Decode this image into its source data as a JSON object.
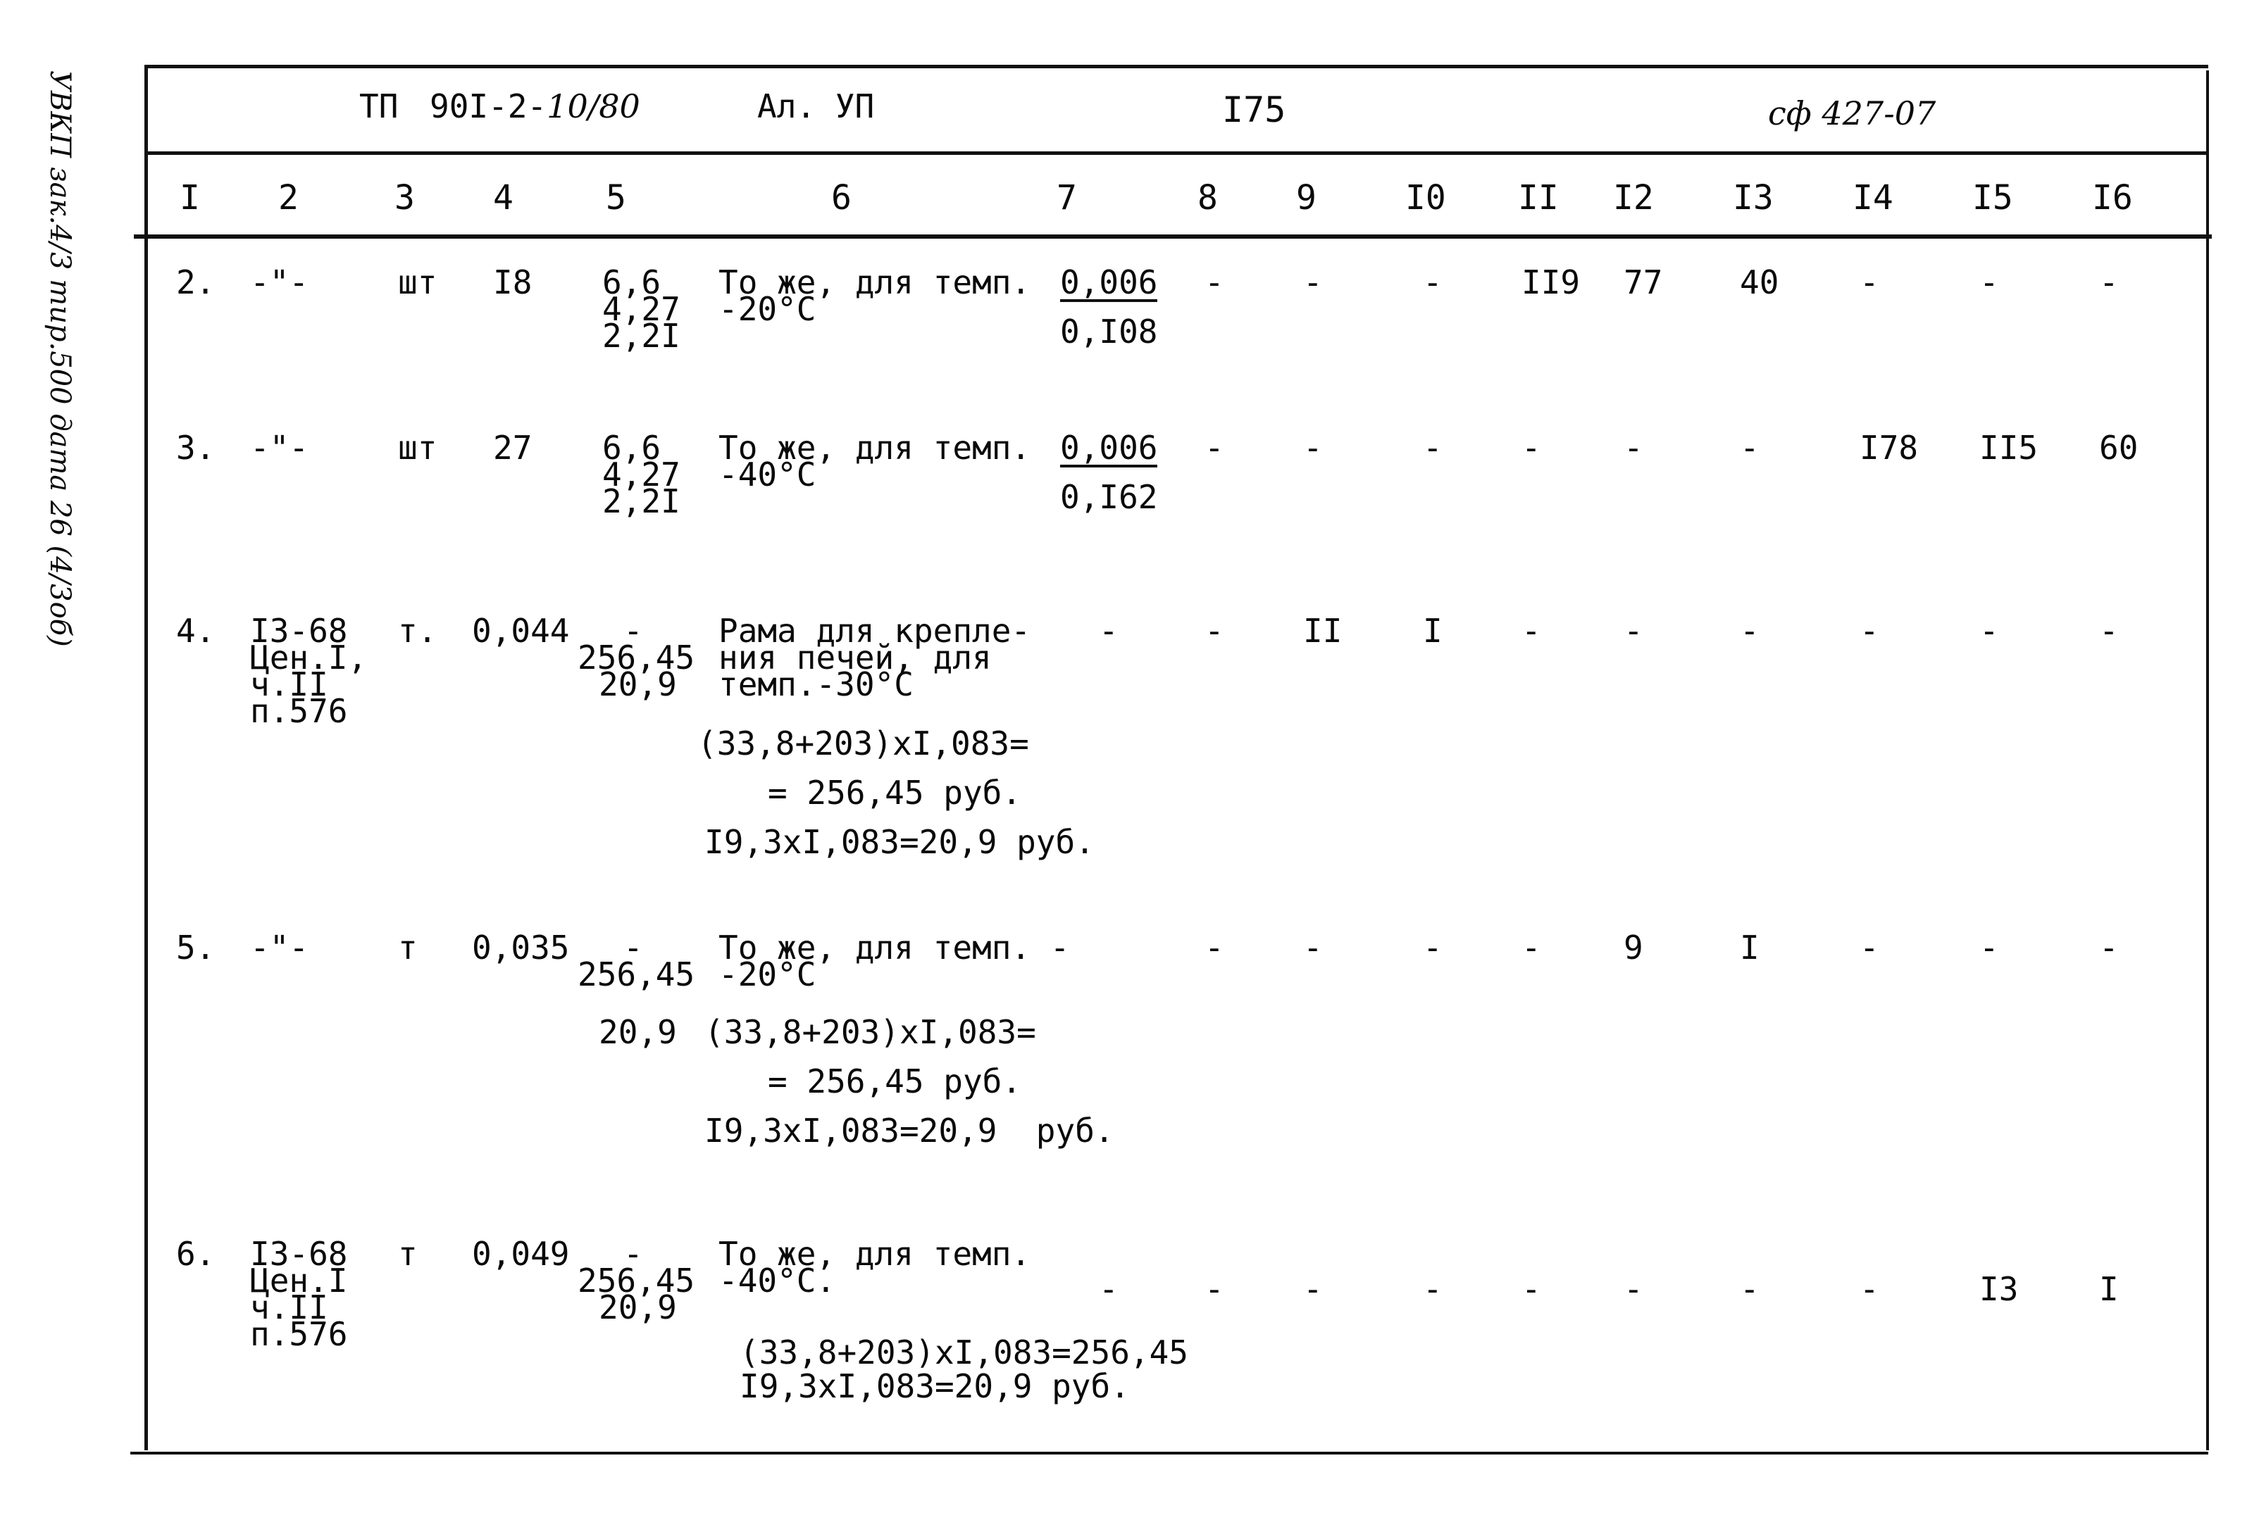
{
  "stamp": {
    "text": "УВКП зак.4/3 тир.500 дата 26 (4/3об)"
  },
  "header": {
    "project": "ТП",
    "code": "90I-2-",
    "code_handwritten": "10/80",
    "album": "Ал. УП",
    "page": "I75",
    "doc_ref": "сф 427-07"
  },
  "columns": [
    "I",
    "2",
    "3",
    "4",
    "5",
    "6",
    "7",
    "8",
    "9",
    "I0",
    "II",
    "I2",
    "I3",
    "I4",
    "I5",
    "I6"
  ],
  "rows": [
    {
      "num": "2.",
      "ref": [
        "-\"-"
      ],
      "unit": "шт",
      "qty": "I8",
      "prices": [
        "6,6",
        "4,27",
        "2,2I"
      ],
      "desc": [
        "То же, для темп.",
        "-20°С"
      ],
      "col7_top": "0,006",
      "col7_bottom": "0,I08",
      "cols": [
        "-",
        "-",
        "-",
        "II9",
        "77",
        "40",
        "-",
        "-",
        "-"
      ]
    },
    {
      "num": "3.",
      "ref": [
        "-\"-"
      ],
      "unit": "шт",
      "qty": "27",
      "prices": [
        "6,6",
        "4,27",
        "2,2I"
      ],
      "desc": [
        "То же, для темп.",
        "-40°С"
      ],
      "col7_top": "0,006",
      "col7_bottom": "0,I62",
      "cols": [
        "-",
        "-",
        "-",
        "-",
        "-",
        "-",
        "I78",
        "II5",
        "60"
      ]
    },
    {
      "num": "4.",
      "ref": [
        "I3-68",
        "Цен.I,",
        "ч.II",
        "п.576"
      ],
      "unit": "т.",
      "qty": "0,044",
      "prices": [
        "-",
        "256,45",
        "20,9"
      ],
      "desc": [
        "Рама для крепле-",
        "ния печей, для",
        "темп.-30°С"
      ],
      "calc": [
        "(33,8+203)xI,083=",
        "= 256,45 руб.",
        "I9,3xI,083=20,9 руб."
      ],
      "col7": "-",
      "cols": [
        "-",
        "II",
        "I",
        "-",
        "-",
        "-",
        "-",
        "-",
        "-"
      ]
    },
    {
      "num": "5.",
      "ref": [
        "-\"-"
      ],
      "unit": "т",
      "qty": "0,035",
      "prices": [
        "-",
        "256,45",
        "20,9"
      ],
      "desc": [
        "То же, для темп. -",
        "-20°С"
      ],
      "calc": [
        "(33,8+203)xI,083=",
        "= 256,45 руб.",
        "I9,3xI,083=20,9  руб."
      ],
      "cols": [
        "-",
        "-",
        "-",
        "-",
        "9",
        "I",
        "-",
        "-",
        "-"
      ]
    },
    {
      "num": "6.",
      "ref": [
        "I3-68",
        "Цен.I",
        "ч.II",
        "п.576"
      ],
      "unit": "т",
      "qty": "0,049",
      "prices": [
        "-",
        "256,45",
        "20,9"
      ],
      "desc": [
        "То же, для темп.",
        "-40°С."
      ],
      "calc": [
        "(33,8+203)xI,083=256,45",
        "I9,3xI,083=20,9 руб."
      ],
      "col7": "-",
      "cols": [
        "-",
        "-",
        "-",
        "-",
        "-",
        "-",
        "-",
        "I3",
        "I"
      ]
    }
  ]
}
